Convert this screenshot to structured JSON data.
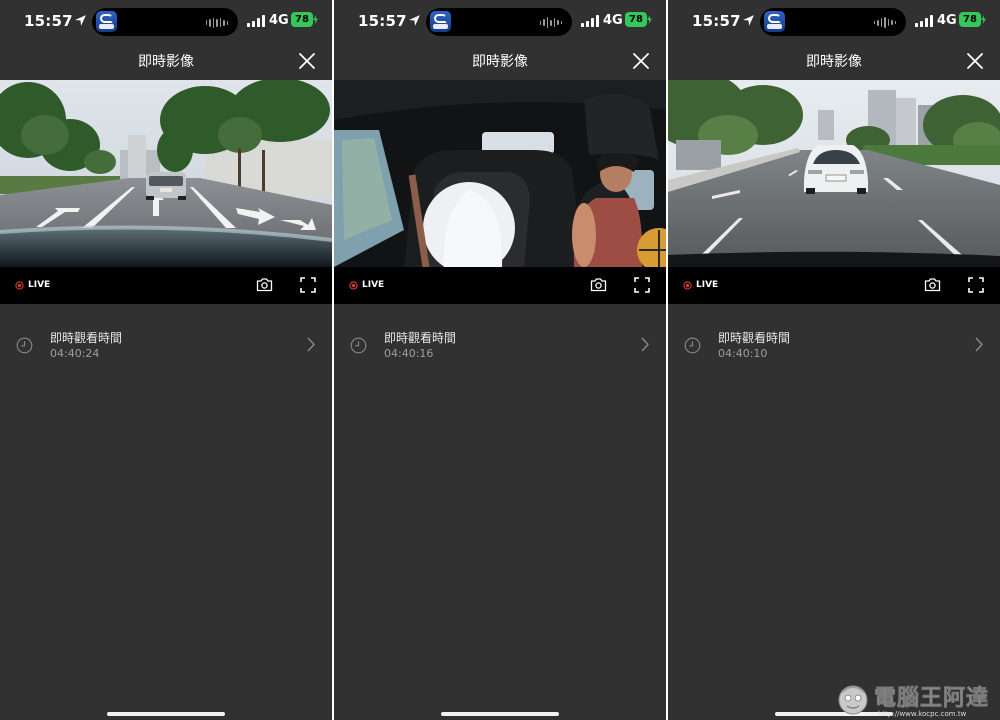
{
  "statusbar": {
    "time": "15:57",
    "network": "4G",
    "battery": "78"
  },
  "app": {
    "title": "即時影像",
    "live_label": "LIVE",
    "row_title": "即時觀看時間"
  },
  "panels": [
    {
      "view": "front-road-camera",
      "watch_time": "04:40:24"
    },
    {
      "view": "interior-cabin-camera",
      "watch_time": "04:40:16"
    },
    {
      "view": "rear-road-camera",
      "watch_time": "04:40:10"
    }
  ],
  "icons": [
    "location-arrow-icon",
    "cellular-signal-icon",
    "battery-icon",
    "close-icon",
    "live-record-dot-icon",
    "camera-icon",
    "fullscreen-icon",
    "clock-icon",
    "chevron-right-icon"
  ],
  "colors": {
    "background": "#313131",
    "controls_bar": "#000000",
    "battery": "#34c759",
    "live_dot": "#e0392d"
  },
  "watermark": {
    "name": "電腦王阿達",
    "url": "http://www.kocpc.com.tw"
  }
}
